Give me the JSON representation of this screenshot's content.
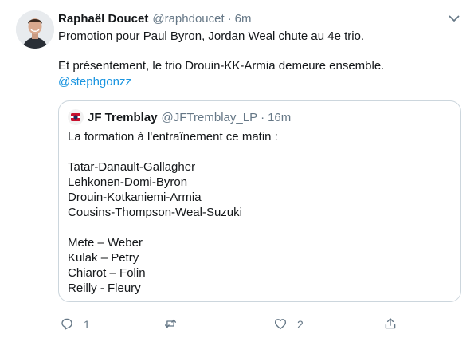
{
  "tweet": {
    "author_name": "Raphaël Doucet",
    "author_handle": "@raphdoucet",
    "separator": "·",
    "time": "6m",
    "lines": [
      "Promotion pour Paul Byron, Jordan Weal chute au 4e trio.",
      "Et présentement, le trio Drouin-KK-Armia demeure ensemble."
    ],
    "mention": "@stephgonzz"
  },
  "quoted": {
    "author_name": "JF Tremblay",
    "author_handle": "@JFTremblay_LP",
    "separator": "·",
    "time": "16m",
    "intro": "La formation à l'entraînement ce matin :",
    "forwards": [
      "Tatar-Danault-Gallagher",
      "Lehkonen-Domi-Byron",
      "Drouin-Kotkaniemi-Armia",
      "Cousins-Thompson-Weal-Suzuki"
    ],
    "defense": [
      "Mete – Weber",
      "Kulak – Petry",
      "Chiarot – Folin",
      "Reilly - Fleury"
    ]
  },
  "actions": {
    "reply_count": "1",
    "retweet_count": "",
    "like_count": "2"
  },
  "icons": {
    "caret": "chevron-down-icon",
    "reply": "reply-icon",
    "retweet": "retweet-icon",
    "like": "heart-icon",
    "share": "share-icon"
  },
  "colors": {
    "text": "#14171a",
    "secondary": "#657786",
    "link": "#1b95e0",
    "border": "#ccd6dd"
  }
}
